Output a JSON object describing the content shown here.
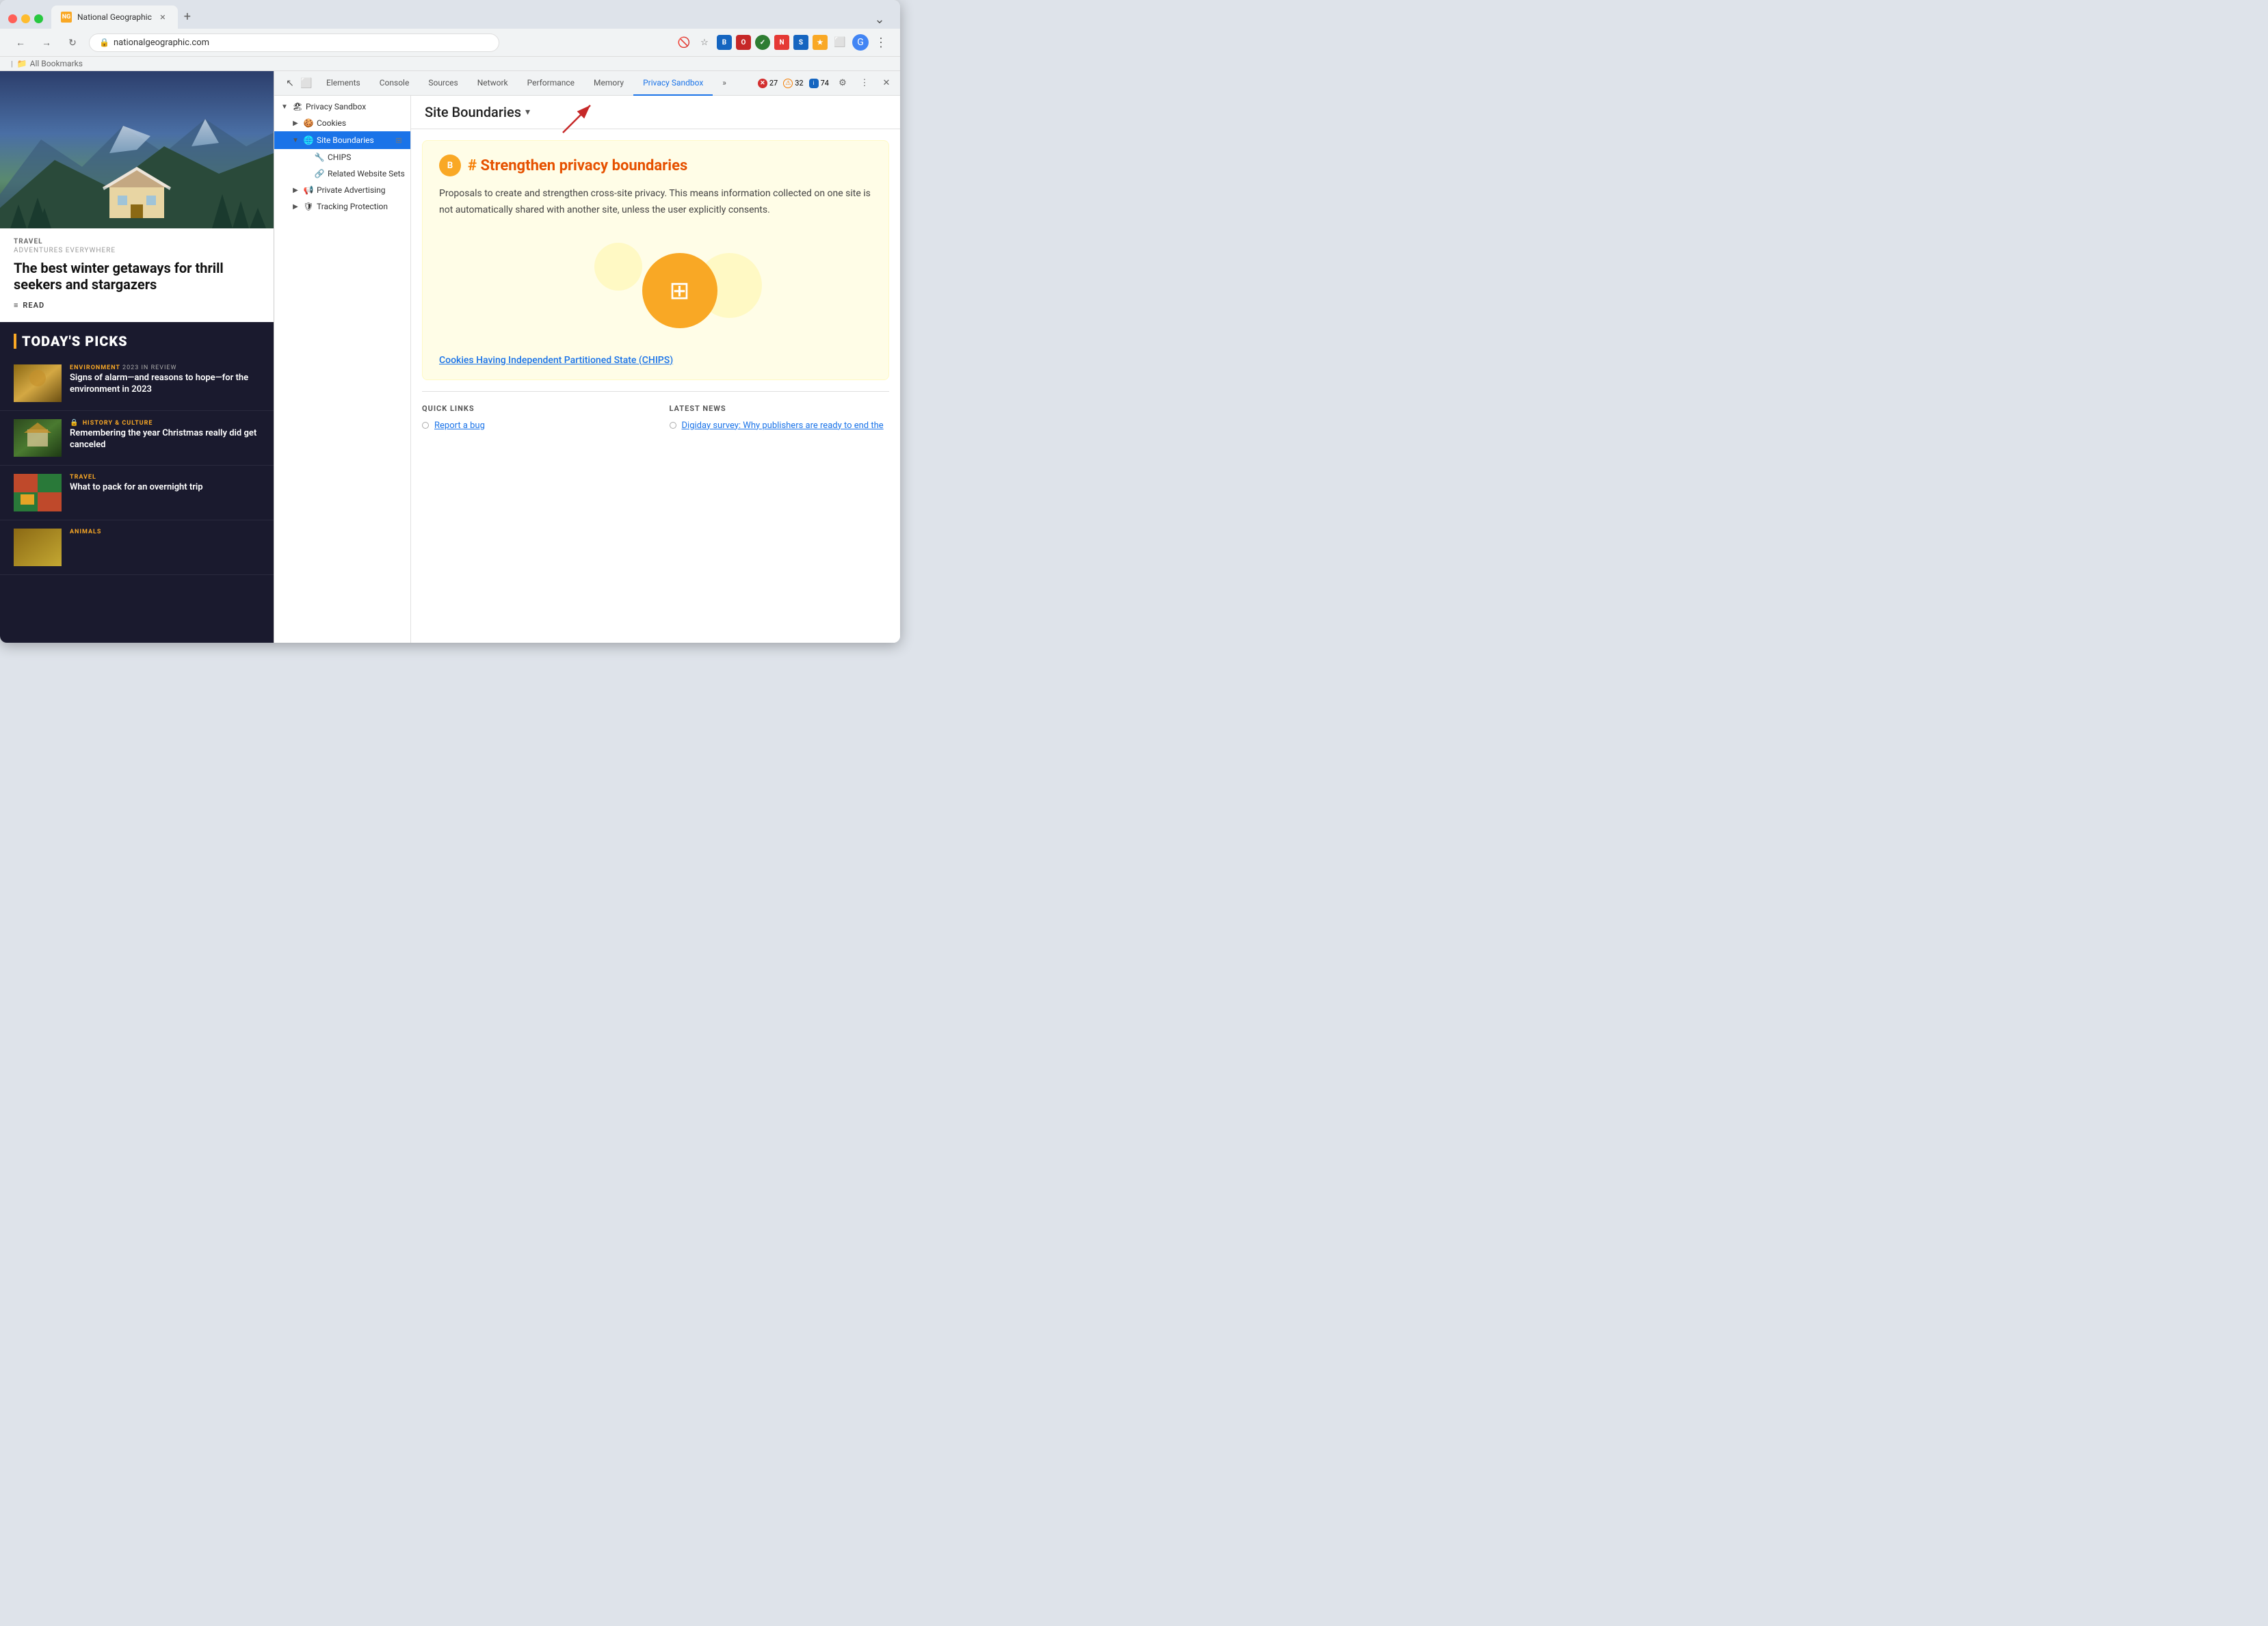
{
  "browser": {
    "tab_title": "National Geographic",
    "tab_favicon": "NG",
    "url": "nationalgeographic.com",
    "bookmarks_label": "All Bookmarks"
  },
  "devtools": {
    "tabs": [
      "Elements",
      "Console",
      "Sources",
      "Network",
      "Performance",
      "Memory",
      "Privacy Sandbox"
    ],
    "active_tab": "Privacy Sandbox",
    "more_label": "»",
    "error_count": "27",
    "warning_count": "32",
    "info_count": "74",
    "tree": {
      "items": [
        {
          "id": "privacy-sandbox",
          "label": "Privacy Sandbox",
          "level": 0,
          "expandable": true,
          "expanded": true
        },
        {
          "id": "cookies",
          "label": "Cookies",
          "level": 1,
          "expandable": true
        },
        {
          "id": "site-boundaries",
          "label": "Site Boundaries",
          "level": 1,
          "expandable": true,
          "selected": true
        },
        {
          "id": "chips",
          "label": "CHIPS",
          "level": 2
        },
        {
          "id": "related-website-sets",
          "label": "Related Website Sets",
          "level": 2
        },
        {
          "id": "private-advertising",
          "label": "Private Advertising",
          "level": 1,
          "expandable": true
        },
        {
          "id": "tracking-protection",
          "label": "Tracking Protection",
          "level": 1,
          "expandable": true
        }
      ]
    },
    "panel": {
      "title": "Site Boundaries",
      "title_dropdown": "▾",
      "info_badge": "B",
      "section_heading": "# Strengthen privacy boundaries",
      "description": "Proposals to create and strengthen cross-site privacy. This means information collected on one site is not automatically shared with another site, unless the user explicitly consents.",
      "chips_link": "Cookies Having Independent Partitioned State (CHIPS)",
      "quick_links_title": "QUICK LINKS",
      "latest_news_title": "LATEST NEWS",
      "report_bug": "Report a bug",
      "latest_news_item": "Digiday survey: Why publishers are ready to end the"
    }
  },
  "website": {
    "hero_tag": "TRAVEL",
    "hero_subtitle": "ADVENTURES EVERYWHERE",
    "hero_title": "The best winter getaways for thrill seekers and stargazers",
    "read_label": "≡ READ",
    "section_title": "TODAY'S PICKS",
    "picks": [
      {
        "category": "ENVIRONMENT",
        "year_tag": "2023 IN REVIEW",
        "title": "Signs of alarm—and reasons to hope—for the environment in 2023",
        "thumb_class": "pick-thumb-env"
      },
      {
        "category": "HISTORY & CULTURE",
        "lock_icon": "🔒",
        "title": "Remembering the year Christmas really did get canceled",
        "thumb_class": "pick-thumb-hist"
      },
      {
        "category": "TRAVEL",
        "title": "What to pack for an overnight trip",
        "thumb_class": "pick-thumb-travel"
      },
      {
        "category": "ANIMALS",
        "title": "",
        "thumb_class": "pick-thumb-anim"
      }
    ]
  },
  "icons": {
    "back": "←",
    "forward": "→",
    "reload": "↻",
    "star": "☆",
    "lock": "🔒",
    "cursor": "↖",
    "device": "⬜",
    "settings": "⚙",
    "more": "⋮",
    "close": "✕",
    "expand": "⌄",
    "fence": "⊞",
    "menu": "≡",
    "new_tab": "+",
    "arrow_right": "→",
    "triangle_right": "▶",
    "triangle_down": "▼"
  }
}
